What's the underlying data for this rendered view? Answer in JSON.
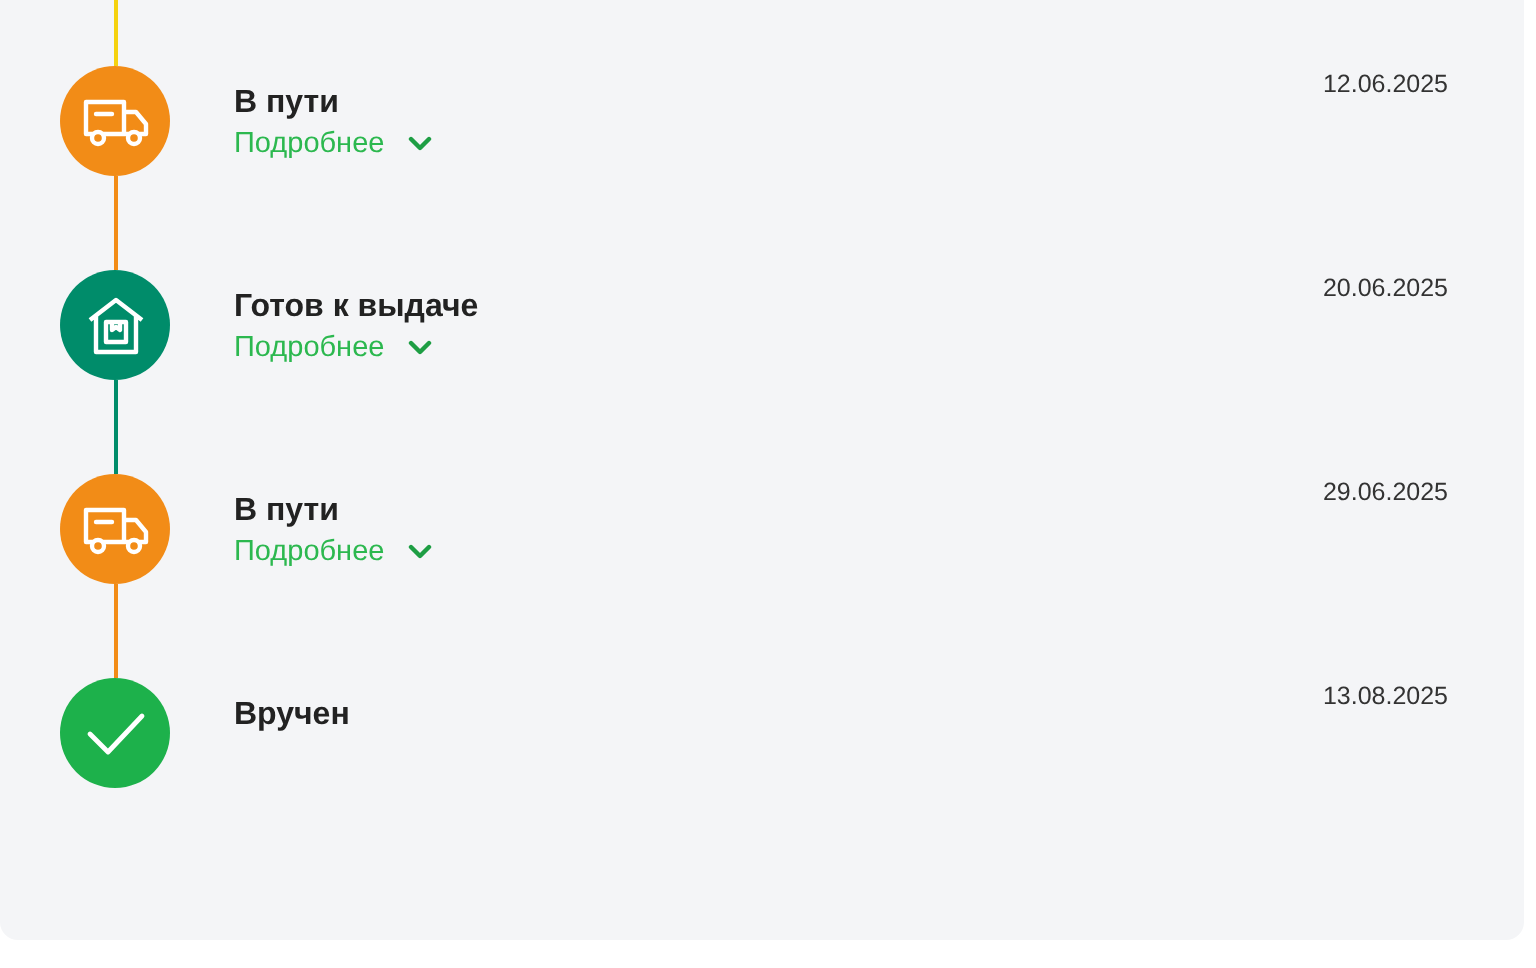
{
  "timeline": {
    "lead_line": {
      "color": "#f5d20f"
    },
    "events": [
      {
        "kind": "truck",
        "color": "#f28c17",
        "status": "В пути",
        "details": "Подробнее",
        "expanded": false,
        "date": "12.06.2025"
      },
      {
        "kind": "warehouse",
        "color": "#008c6a",
        "status": "Готов к выдаче",
        "details": "Подробнее",
        "expanded": false,
        "date": "20.06.2025"
      },
      {
        "kind": "truck",
        "color": "#f28c17",
        "status": "В пути",
        "details": "Подробнее",
        "expanded": false,
        "date": "29.06.2025"
      },
      {
        "kind": "check",
        "color": "#1db14b",
        "status": "Вручен",
        "date": "13.08.2025"
      }
    ]
  }
}
